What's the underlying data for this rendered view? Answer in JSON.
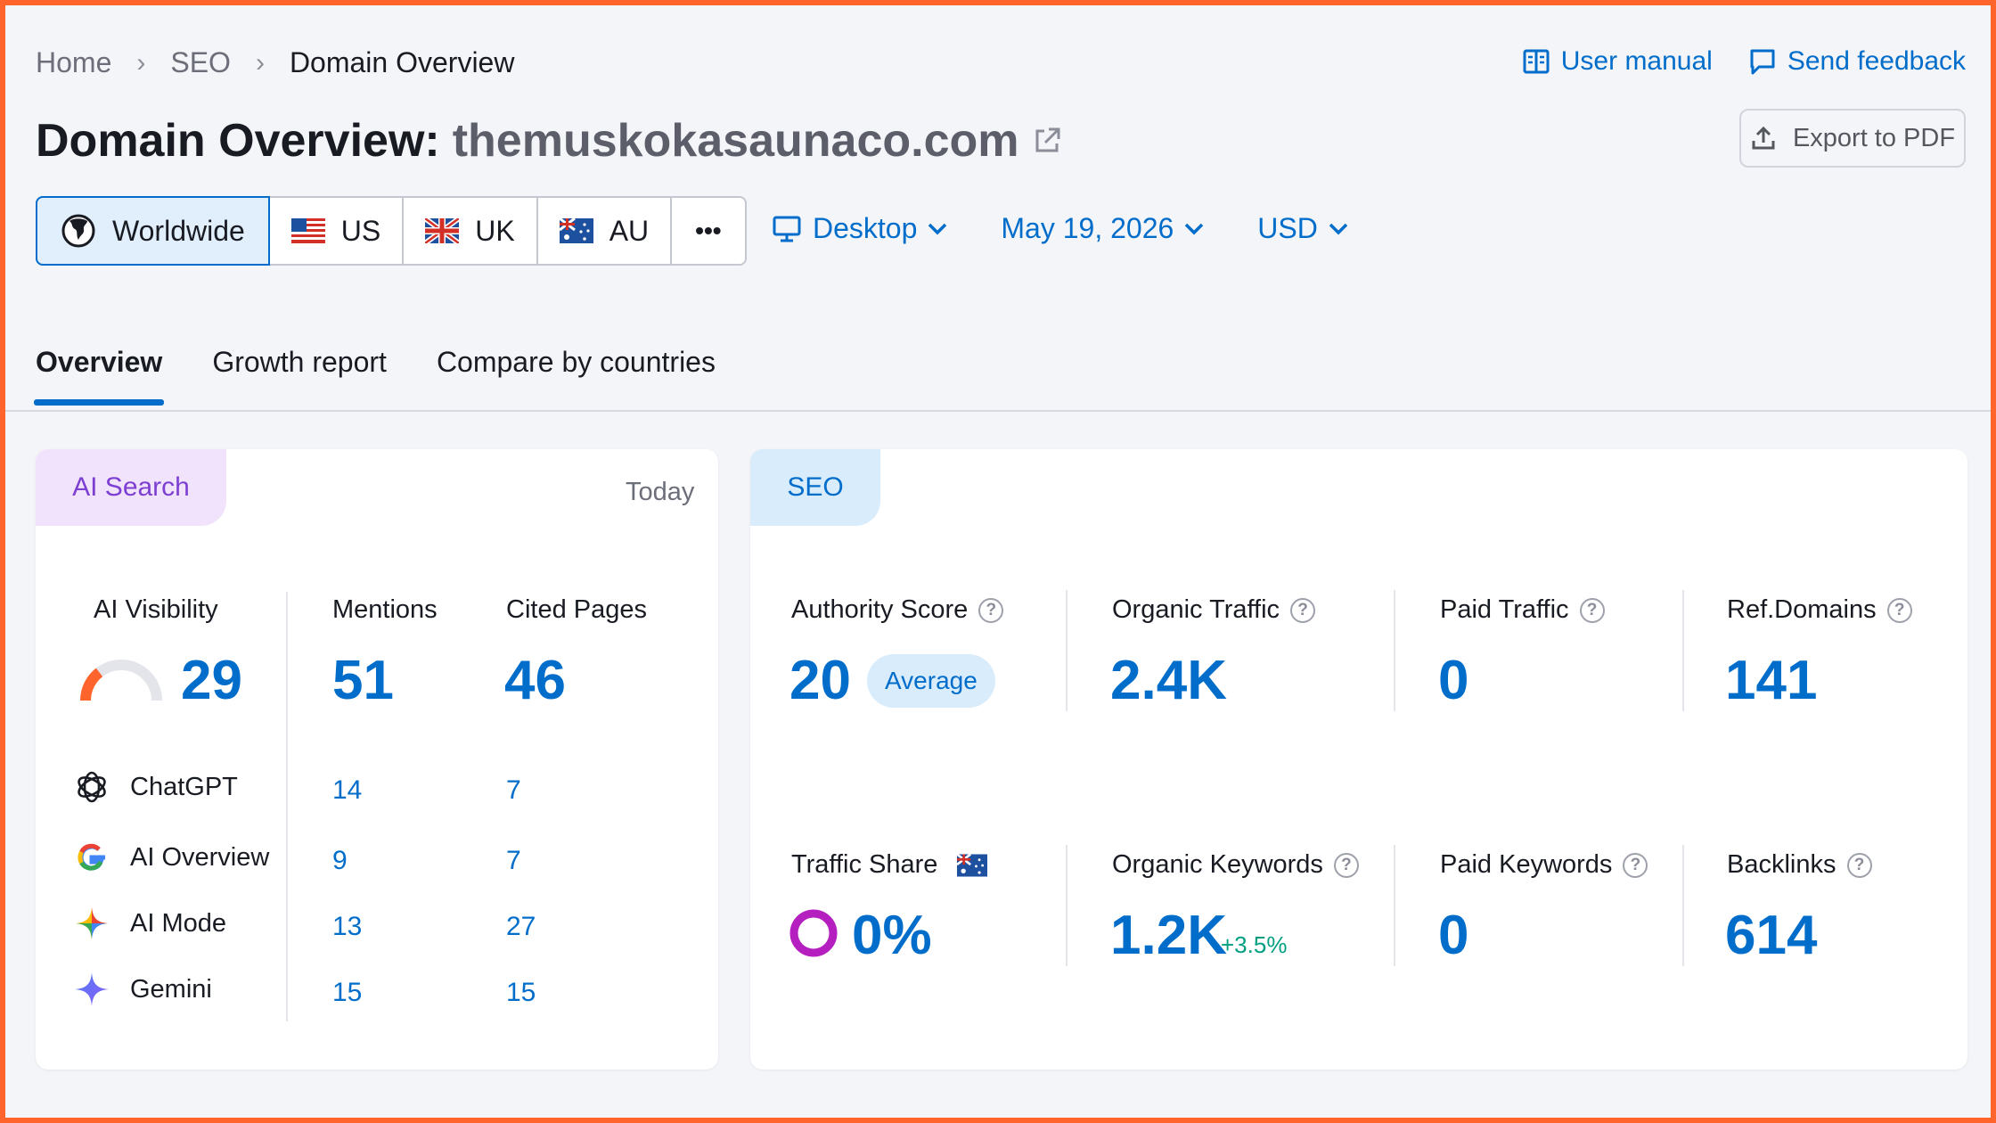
{
  "breadcrumb": [
    "Home",
    "SEO",
    "Domain Overview"
  ],
  "links": {
    "manual": "User manual",
    "feedback": "Send feedback"
  },
  "title": {
    "prefix": "Domain Overview:",
    "domain": "themuskokasaunaco.com"
  },
  "export_label": "Export to PDF",
  "regions": [
    {
      "label": "Worldwide",
      "icon": "globe-icon"
    },
    {
      "label": "US",
      "icon": "us-flag-icon"
    },
    {
      "label": "UK",
      "icon": "uk-flag-icon"
    },
    {
      "label": "AU",
      "icon": "au-flag-icon"
    }
  ],
  "more_label": "•••",
  "device": "Desktop",
  "date": "May 19, 2026",
  "currency": "USD",
  "tabs": [
    "Overview",
    "Growth report",
    "Compare by countries"
  ],
  "ai": {
    "tag": "AI Search",
    "period": "Today",
    "visibility_label": "AI Visibility",
    "visibility": "29",
    "visibility_fraction": 0.29,
    "mentions_label": "Mentions",
    "mentions": "51",
    "cited_label": "Cited Pages",
    "cited": "46",
    "engines": [
      {
        "name": "ChatGPT",
        "mentions": "14",
        "cited": "7",
        "icon": "chatgpt-icon"
      },
      {
        "name": "AI Overview",
        "mentions": "9",
        "cited": "7",
        "icon": "google-icon"
      },
      {
        "name": "AI Mode",
        "mentions": "13",
        "cited": "27",
        "icon": "ai-mode-icon"
      },
      {
        "name": "Gemini",
        "mentions": "15",
        "cited": "15",
        "icon": "gemini-icon"
      }
    ]
  },
  "seo": {
    "tag": "SEO",
    "authority_label": "Authority Score",
    "authority": "20",
    "authority_badge": "Average",
    "organic_traffic_label": "Organic Traffic",
    "organic_traffic": "2.4K",
    "paid_traffic_label": "Paid Traffic",
    "paid_traffic": "0",
    "ref_domains_label": "Ref.Domains",
    "ref_domains": "141",
    "traffic_share_label": "Traffic Share",
    "traffic_share": "0%",
    "organic_keywords_label": "Organic Keywords",
    "organic_keywords": "1.2K",
    "organic_keywords_delta": "+3.5%",
    "paid_keywords_label": "Paid Keywords",
    "paid_keywords": "0",
    "backlinks_label": "Backlinks",
    "backlinks": "614"
  },
  "colors": {
    "accent": "#006dca",
    "frame": "#ff642d",
    "ai_purple": "#7d3fd1",
    "positive": "#009f81"
  }
}
